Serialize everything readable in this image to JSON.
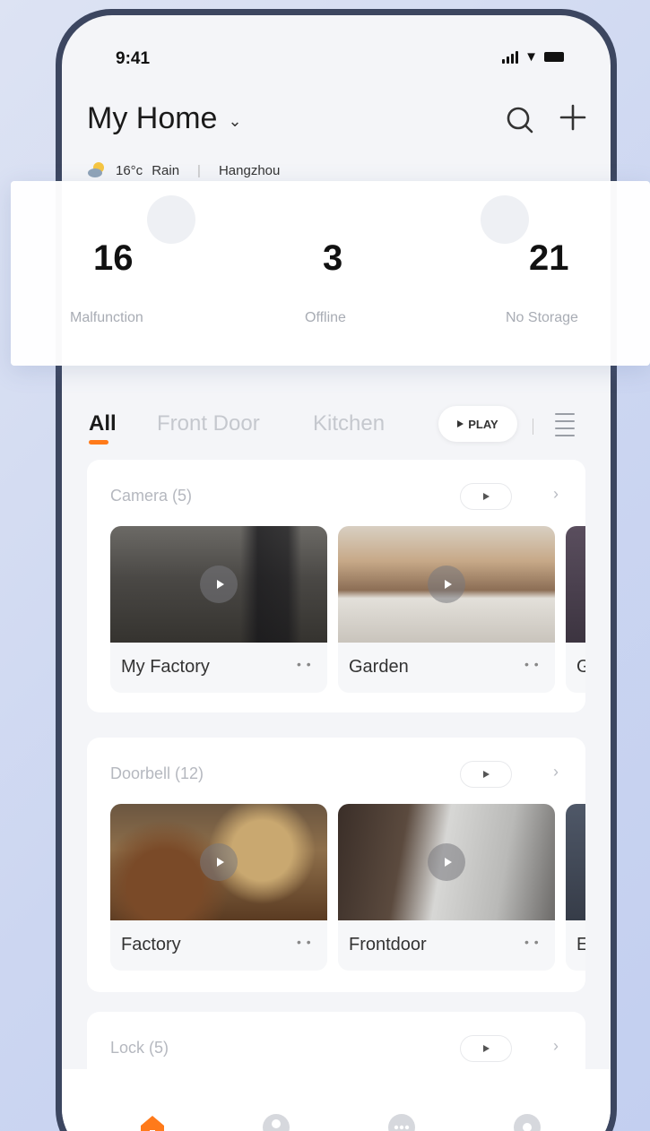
{
  "status_bar": {
    "time": "9:41"
  },
  "header": {
    "home_title": "My Home"
  },
  "weather": {
    "temperature": "16°c",
    "condition": "Rain",
    "city": "Hangzhou"
  },
  "stats": [
    {
      "value": "16",
      "label": "Malfunction"
    },
    {
      "value": "3",
      "label": "Offline"
    },
    {
      "value": "21",
      "label": "No Storage"
    }
  ],
  "tabs": {
    "items": [
      "All",
      "Front Door",
      "Kitchen"
    ],
    "play_label": "PLAY"
  },
  "sections": {
    "camera": {
      "title": "Camera (5)",
      "cards": [
        {
          "name": "My Factory",
          "more": "• •"
        },
        {
          "name": "Garden",
          "more": "• •"
        },
        {
          "name": "G"
        }
      ]
    },
    "doorbell": {
      "title": "Doorbell (12)",
      "cards": [
        {
          "name": "Factory",
          "more": "• •"
        },
        {
          "name": "Frontdoor",
          "more": "• •"
        },
        {
          "name": "E"
        }
      ]
    },
    "lock": {
      "title": "Lock (5)"
    }
  },
  "colors": {
    "accent": "#ff7a1a",
    "muted_text": "#a8acb4",
    "frame": "#3c4660"
  },
  "tabbar_icons": [
    "home-icon",
    "profile-icon",
    "chat-icon",
    "settings-icon"
  ]
}
